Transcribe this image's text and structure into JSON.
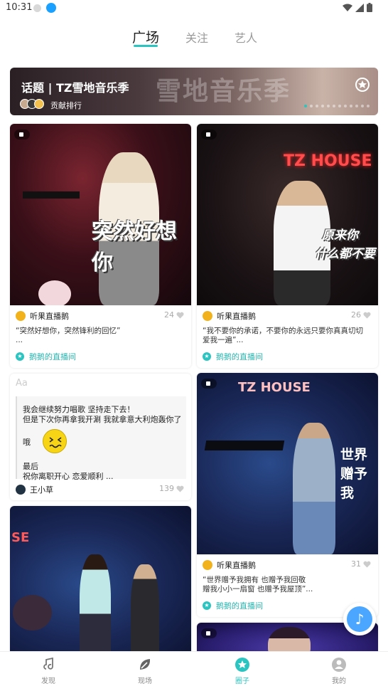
{
  "status_bar": {
    "time": "10:31"
  },
  "top_tabs": [
    {
      "label": "广场",
      "active": true
    },
    {
      "label": "关注",
      "active": false
    },
    {
      "label": "艺人",
      "active": false
    }
  ],
  "banner": {
    "title": "话题 | TZ雪地音乐季",
    "bg_text": "雪地音乐季",
    "rank_label": "贡献排行"
  },
  "posts": [
    {
      "overlay": "突然好想你",
      "author": "听果直播鹅",
      "likes": "24",
      "text_line1": "“突然好想你，突然锋利的回忆”",
      "text_line2": "...",
      "room": "鹅鹅的直播间"
    },
    {
      "overlay_sign": "TZ HOUSE",
      "overlay_line1": "原来你",
      "overlay_line2": "什么都不要",
      "author": "听果直播鹅",
      "likes": "26",
      "text_line1": "“我不要你的承诺，不要你的永远只要你真真切切",
      "text_line2": "爱我一遍”...",
      "room": "鹅鹅的直播间"
    },
    {
      "author": "王小草",
      "likes": "139",
      "lines": [
        "我会继续努力唱歌 坚持走下去！",
        "但是下次你再拿我开涮 我就拿意大利炮轰你了",
        "哦",
        "最后",
        "祝你离职开心 恋爱顺利 ..."
      ]
    },
    {
      "overlay_sign": "TZ HOUSE",
      "overlay_text": "世界赠予我",
      "author": "听果直播鹅",
      "likes": "31",
      "text_line1": "“世界赠予我拥有 也赠予我回敬",
      "text_line2": "赠我小小一扇窗 也赠予我屋顶”...",
      "room": "鹅鹅的直播间"
    },
    {
      "overlay_sign": "SE"
    },
    {}
  ],
  "bottom_nav": [
    {
      "label": "发现",
      "icon": "music-note-icon",
      "active": false
    },
    {
      "label": "现场",
      "icon": "leaf-icon",
      "active": false
    },
    {
      "label": "圈子",
      "icon": "star-circle-icon",
      "active": true
    },
    {
      "label": "我的",
      "icon": "person-icon",
      "active": false
    }
  ],
  "colors": {
    "accent": "#2bc4c0",
    "room_text": "#2bb5b0",
    "fab": "#4aa6ff"
  }
}
